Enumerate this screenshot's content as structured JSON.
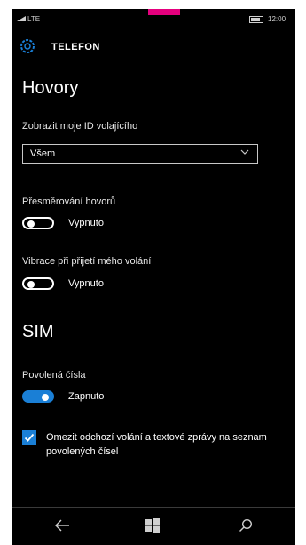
{
  "statusbar": {
    "network": "LTE",
    "time": "12:00"
  },
  "appbar": {
    "title": "TELEFON",
    "icon": "gear-icon"
  },
  "calls": {
    "heading": "Hovory",
    "caller_id": {
      "label": "Zobrazit moje ID volajícího",
      "value": "Všem"
    },
    "forwarding": {
      "label": "Přesměrování hovorů",
      "state": "Vypnuto",
      "on": false
    },
    "vibrate": {
      "label": "Vibrace při přijetí mého volání",
      "state": "Vypnuto",
      "on": false
    }
  },
  "sim": {
    "heading": "SIM",
    "fixed_numbers": {
      "label": "Povolená čísla",
      "state": "Zapnuto",
      "on": true
    },
    "restrict": {
      "label": "Omezit odchozí volání a textové zprávy na seznam povolených čísel",
      "checked": true
    }
  },
  "navbar": {
    "items": [
      "back-icon",
      "windows-icon",
      "search-icon"
    ]
  },
  "colors": {
    "accent": "#1a7fd6",
    "background": "#000000",
    "brand_mark": "#e5007e"
  }
}
